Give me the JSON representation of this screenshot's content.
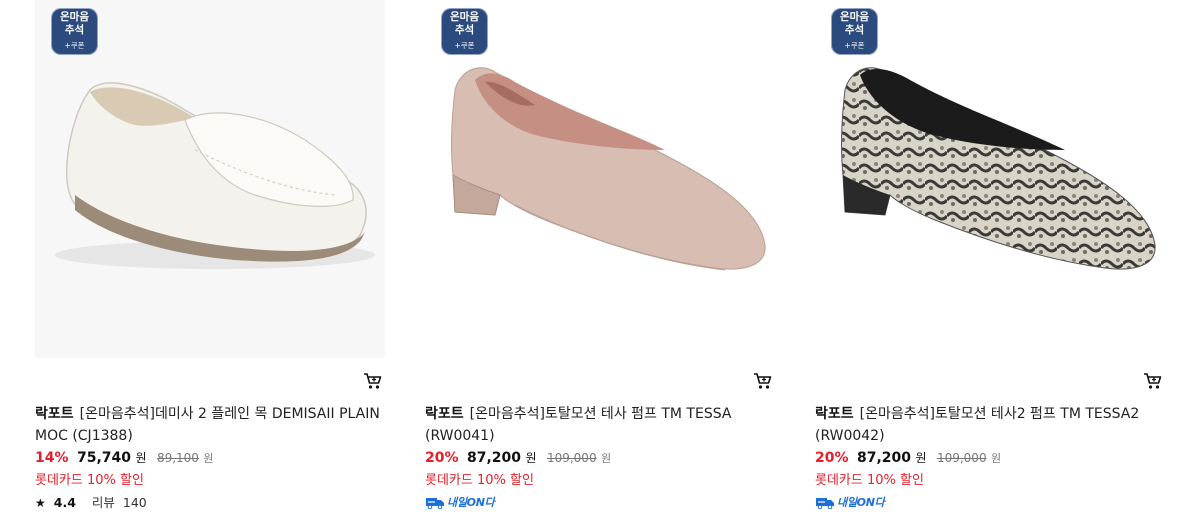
{
  "products": [
    {
      "badge": {
        "line1": "온마음",
        "line2": "추석",
        "line3": "+쿠폰"
      },
      "brand": "락포트",
      "name": "[온마음추석]데미사 2 플레인 목 DEMISAII PLAIN MOC (CJ1388)",
      "discount": "14%",
      "price": "75,740",
      "currency": "원",
      "original_price": "89,100",
      "original_currency": "원",
      "promo": "롯데카드 10% 할인",
      "rating": "4.4",
      "review_label": "리뷰",
      "review_count": "140"
    },
    {
      "badge": {
        "line1": "온마음",
        "line2": "추석",
        "line3": "+쿠폰"
      },
      "brand": "락포트",
      "name": "[온마음추석]토탈모션 테사 펌프 TM TESSA (RW0041)",
      "discount": "20%",
      "price": "87,200",
      "currency": "원",
      "original_price": "109,000",
      "original_currency": "원",
      "promo": "롯데카드 10% 할인",
      "delivery_label": "내일ON다"
    },
    {
      "badge": {
        "line1": "온마음",
        "line2": "추석",
        "line3": "+쿠폰"
      },
      "brand": "락포트",
      "name": "[온마음추석]토탈모션 테사2 펌프 TM TESSA2 (RW0042)",
      "discount": "20%",
      "price": "87,200",
      "currency": "원",
      "original_price": "109,000",
      "original_currency": "원",
      "promo": "롯데카드 10% 할인",
      "delivery_label": "내일ON다"
    }
  ],
  "icons": {
    "cart": "cart-icon",
    "star": "star-icon",
    "delivery": "truck-icon"
  },
  "colors": {
    "discount": "#e61e2b",
    "badge": "#2b4a7d",
    "delivery": "#1d6fd8"
  }
}
